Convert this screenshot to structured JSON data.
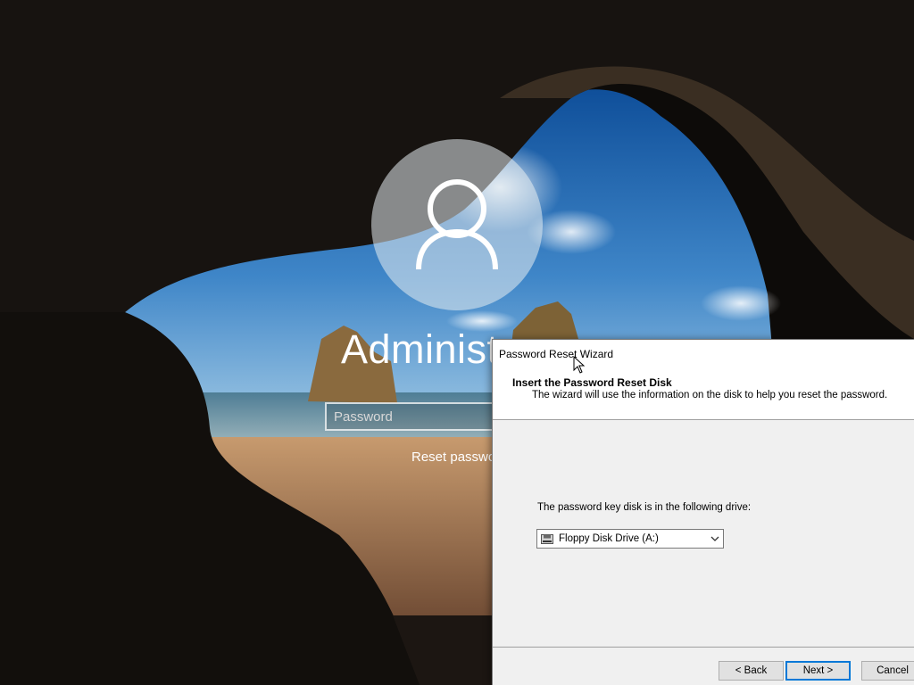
{
  "lock_screen": {
    "username": "Administ",
    "password_placeholder": "Password",
    "reset_link": "Reset passwo"
  },
  "wizard": {
    "title": "Password Reset Wizard",
    "heading": "Insert the Password Reset Disk",
    "subheading": "The wizard will use the information on the disk to help you reset the password.",
    "drive_label": "The password key disk is in the following drive:",
    "drive_selected": "Floppy Disk Drive (A:)",
    "buttons": {
      "back": "< Back",
      "next": "Next >",
      "cancel": "Cancel"
    }
  },
  "icons": {
    "avatar": "user-silhouette-icon",
    "drive": "floppy-drive-icon",
    "dropdown": "chevron-down-icon",
    "cursor": "mouse-pointer-icon"
  },
  "colors": {
    "focus_accent": "#0078d7",
    "dialog_bg": "#f0f0f0",
    "sky": "#1e5a9c"
  }
}
